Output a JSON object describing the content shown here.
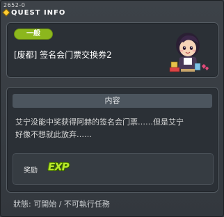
{
  "window": {
    "quest_id": "2652-0",
    "title": "QUEST INFO"
  },
  "quest": {
    "category": "一般",
    "name": "[废都] 签名会门票交换券2"
  },
  "content": {
    "header": "内容",
    "line1": "艾宁没能中奖获得阿赫的签名会门票……但是艾宁",
    "line2": "好像不想就此放弃……"
  },
  "reward": {
    "label": "奖励",
    "icon": "exp-icon",
    "icon_text": "EXP"
  },
  "status": "狀態: 可開始 / 不可執行任務",
  "colors": {
    "badge": "#8cb71d",
    "exp": "#b8e82a",
    "panel": "#2b3036"
  }
}
